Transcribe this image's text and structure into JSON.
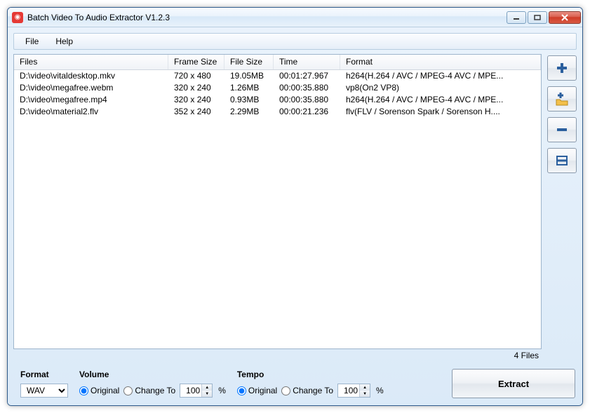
{
  "title": "Batch Video To Audio Extractor V1.2.3",
  "menu": {
    "file": "File",
    "help": "Help"
  },
  "columns": {
    "files": "Files",
    "frame": "Frame Size",
    "size": "File Size",
    "time": "Time",
    "format": "Format"
  },
  "rows": [
    {
      "files": "D:\\video\\vitaldesktop.mkv",
      "frame": "720 x 480",
      "size": "19.05MB",
      "time": "00:01:27.967",
      "format": "h264(H.264 / AVC / MPEG-4 AVC / MPE..."
    },
    {
      "files": "D:\\video\\megafree.webm",
      "frame": "320 x 240",
      "size": "1.26MB",
      "time": "00:00:35.880",
      "format": "vp8(On2 VP8)"
    },
    {
      "files": "D:\\video\\megafree.mp4",
      "frame": "320 x 240",
      "size": "0.93MB",
      "time": "00:00:35.880",
      "format": "h264(H.264 / AVC / MPEG-4 AVC / MPE..."
    },
    {
      "files": "D:\\video\\material2.flv",
      "frame": "352 x 240",
      "size": "2.29MB",
      "time": "00:00:21.236",
      "format": "flv(FLV / Sorenson Spark / Sorenson H...."
    }
  ],
  "file_count": "4 Files",
  "format_group": {
    "label": "Format",
    "value": "WAV"
  },
  "volume_group": {
    "label": "Volume",
    "original": "Original",
    "change_to": "Change To",
    "value": "100",
    "pct": "%"
  },
  "tempo_group": {
    "label": "Tempo",
    "original": "Original",
    "change_to": "Change To",
    "value": "100",
    "pct": "%"
  },
  "extract": "Extract"
}
